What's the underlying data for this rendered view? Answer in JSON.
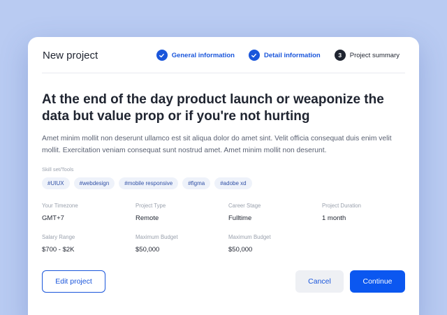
{
  "header": {
    "title": "New project"
  },
  "stepper": {
    "steps": [
      {
        "label": "General information",
        "state": "done"
      },
      {
        "label": "Detail information",
        "state": "done"
      },
      {
        "label": "Project summary",
        "number": "3",
        "state": "current"
      }
    ]
  },
  "summary": {
    "headline": "At the end of the day product launch or weaponize the data but value prop or if you're not hurting",
    "description": "Amet minim mollit non deserunt ullamco est sit aliqua dolor do amet sint. Velit officia consequat duis enim velit mollit. Exercitation veniam consequat sunt nostrud amet. Amet minim mollit non deserunt.",
    "skills_label": "Skill set/Tools",
    "tags": [
      "#UIUX",
      "#webdesign",
      "#mobile responsive",
      "#figma",
      "#adobe xd"
    ]
  },
  "details": {
    "timezone": {
      "label": "Your Timezone",
      "value": "GMT+7"
    },
    "project_type": {
      "label": "Project Type",
      "value": "Remote"
    },
    "career_stage": {
      "label": "Career Stage",
      "value": "Fulltime"
    },
    "project_duration": {
      "label": "Project Duration",
      "value": "1 month"
    },
    "salary_range": {
      "label": "Salary Range",
      "value": "$700 - $2K"
    },
    "max_budget_1": {
      "label": "Maximum Budget",
      "value": "$50,000"
    },
    "max_budget_2": {
      "label": "Maximum Budget",
      "value": "$50,000"
    }
  },
  "actions": {
    "edit_label": "Edit project",
    "cancel_label": "Cancel",
    "continue_label": "Continue"
  },
  "colors": {
    "background": "#b9cbf2",
    "primary": "#0b57f0",
    "accent": "#1a56db",
    "tag_bg": "#eef2fa"
  },
  "icons": {
    "completed_step": "check-icon"
  }
}
